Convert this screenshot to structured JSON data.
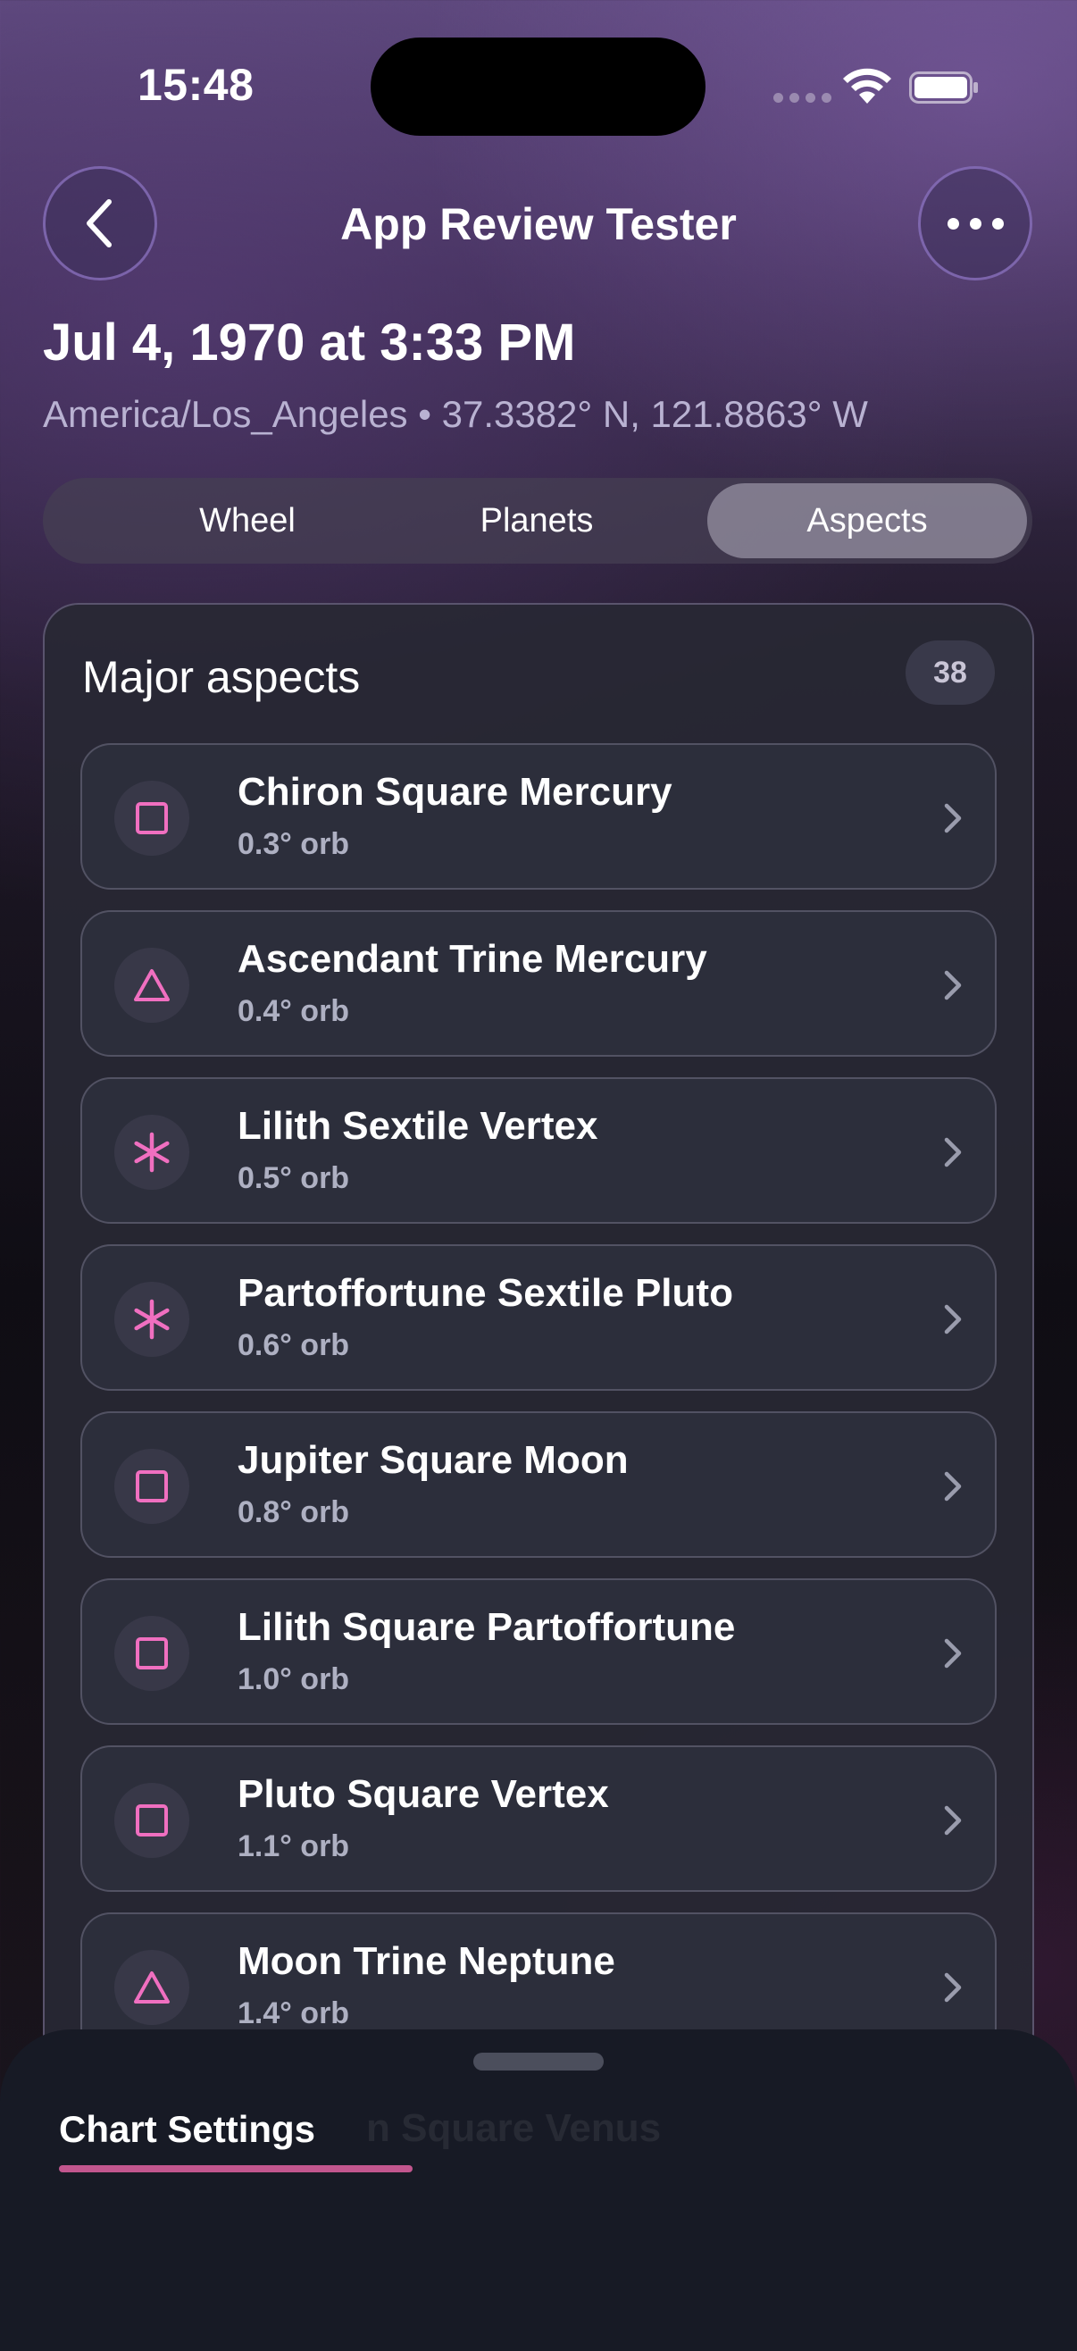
{
  "status_bar": {
    "time": "15:48"
  },
  "nav": {
    "title": "App Review Tester"
  },
  "header": {
    "date": "Jul 4, 1970 at 3:33 PM",
    "location": "America/Los_Angeles • 37.3382° N, 121.8863° W"
  },
  "tabs": [
    {
      "label": "Wheel",
      "selected": false
    },
    {
      "label": "Planets",
      "selected": false
    },
    {
      "label": "Aspects",
      "selected": true
    }
  ],
  "aspects_card": {
    "title": "Major aspects",
    "count": "38",
    "items": [
      {
        "name": "Chiron Square Mercury",
        "orb": "0.3° orb",
        "icon": "square-aspect-icon"
      },
      {
        "name": "Ascendant Trine Mercury",
        "orb": "0.4° orb",
        "icon": "trine-aspect-icon"
      },
      {
        "name": "Lilith Sextile Vertex",
        "orb": "0.5° orb",
        "icon": "sextile-aspect-icon"
      },
      {
        "name": "Partoffortune Sextile Pluto",
        "orb": "0.6° orb",
        "icon": "sextile-aspect-icon"
      },
      {
        "name": "Jupiter Square Moon",
        "orb": "0.8° orb",
        "icon": "square-aspect-icon"
      },
      {
        "name": "Lilith Square Partoffortune",
        "orb": "1.0° orb",
        "icon": "square-aspect-icon"
      },
      {
        "name": "Pluto Square Vertex",
        "orb": "1.1° orb",
        "icon": "square-aspect-icon"
      },
      {
        "name": "Moon Trine Neptune",
        "orb": "1.4° orb",
        "icon": "trine-aspect-icon"
      }
    ]
  },
  "bottom_sheet": {
    "tab_label": "Chart Settings",
    "obscured_text": "n Square Venus"
  },
  "colors": {
    "aspect_icon": "#f06fc0",
    "accent_underline": "#c2568e"
  }
}
